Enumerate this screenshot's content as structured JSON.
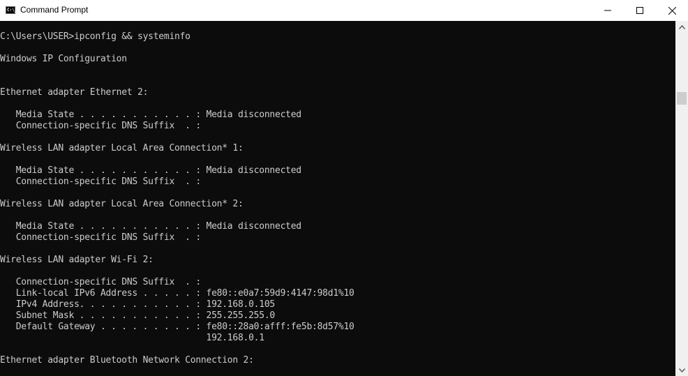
{
  "window": {
    "title": "Command Prompt",
    "icon": "cmd-icon",
    "icon_label": "C:\\_",
    "controls": [
      "minimize-icon",
      "maximize-icon",
      "close-icon"
    ]
  },
  "console": {
    "lines": [
      "C:\\Users\\USER>ipconfig && systeminfo",
      "",
      "Windows IP Configuration",
      "",
      "",
      "Ethernet adapter Ethernet 2:",
      "",
      "   Media State . . . . . . . . . . . : Media disconnected",
      "   Connection-specific DNS Suffix  . :",
      "",
      "Wireless LAN adapter Local Area Connection* 1:",
      "",
      "   Media State . . . . . . . . . . . : Media disconnected",
      "   Connection-specific DNS Suffix  . :",
      "",
      "Wireless LAN adapter Local Area Connection* 2:",
      "",
      "   Media State . . . . . . . . . . . : Media disconnected",
      "   Connection-specific DNS Suffix  . :",
      "",
      "Wireless LAN adapter Wi-Fi 2:",
      "",
      "   Connection-specific DNS Suffix  . :",
      "   Link-local IPv6 Address . . . . . : fe80::e0a7:59d9:4147:98d1%10",
      "   IPv4 Address. . . . . . . . . . . : 192.168.0.105",
      "   Subnet Mask . . . . . . . . . . . : 255.255.255.0",
      "   Default Gateway . . . . . . . . . : fe80::28a0:afff:fe5b:8d57%10",
      "                                       192.168.0.1",
      "",
      "Ethernet adapter Bluetooth Network Connection 2:"
    ]
  },
  "colors": {
    "console_bg": "#0c0c0c",
    "console_fg": "#cccccc",
    "titlebar_bg": "#ffffff",
    "scrollbar_bg": "#f0f0f0",
    "scrollbar_thumb": "#cdcdcd"
  },
  "scrollbar": {
    "up_icon": "chevron-up-icon",
    "down_icon": "chevron-down-icon"
  }
}
